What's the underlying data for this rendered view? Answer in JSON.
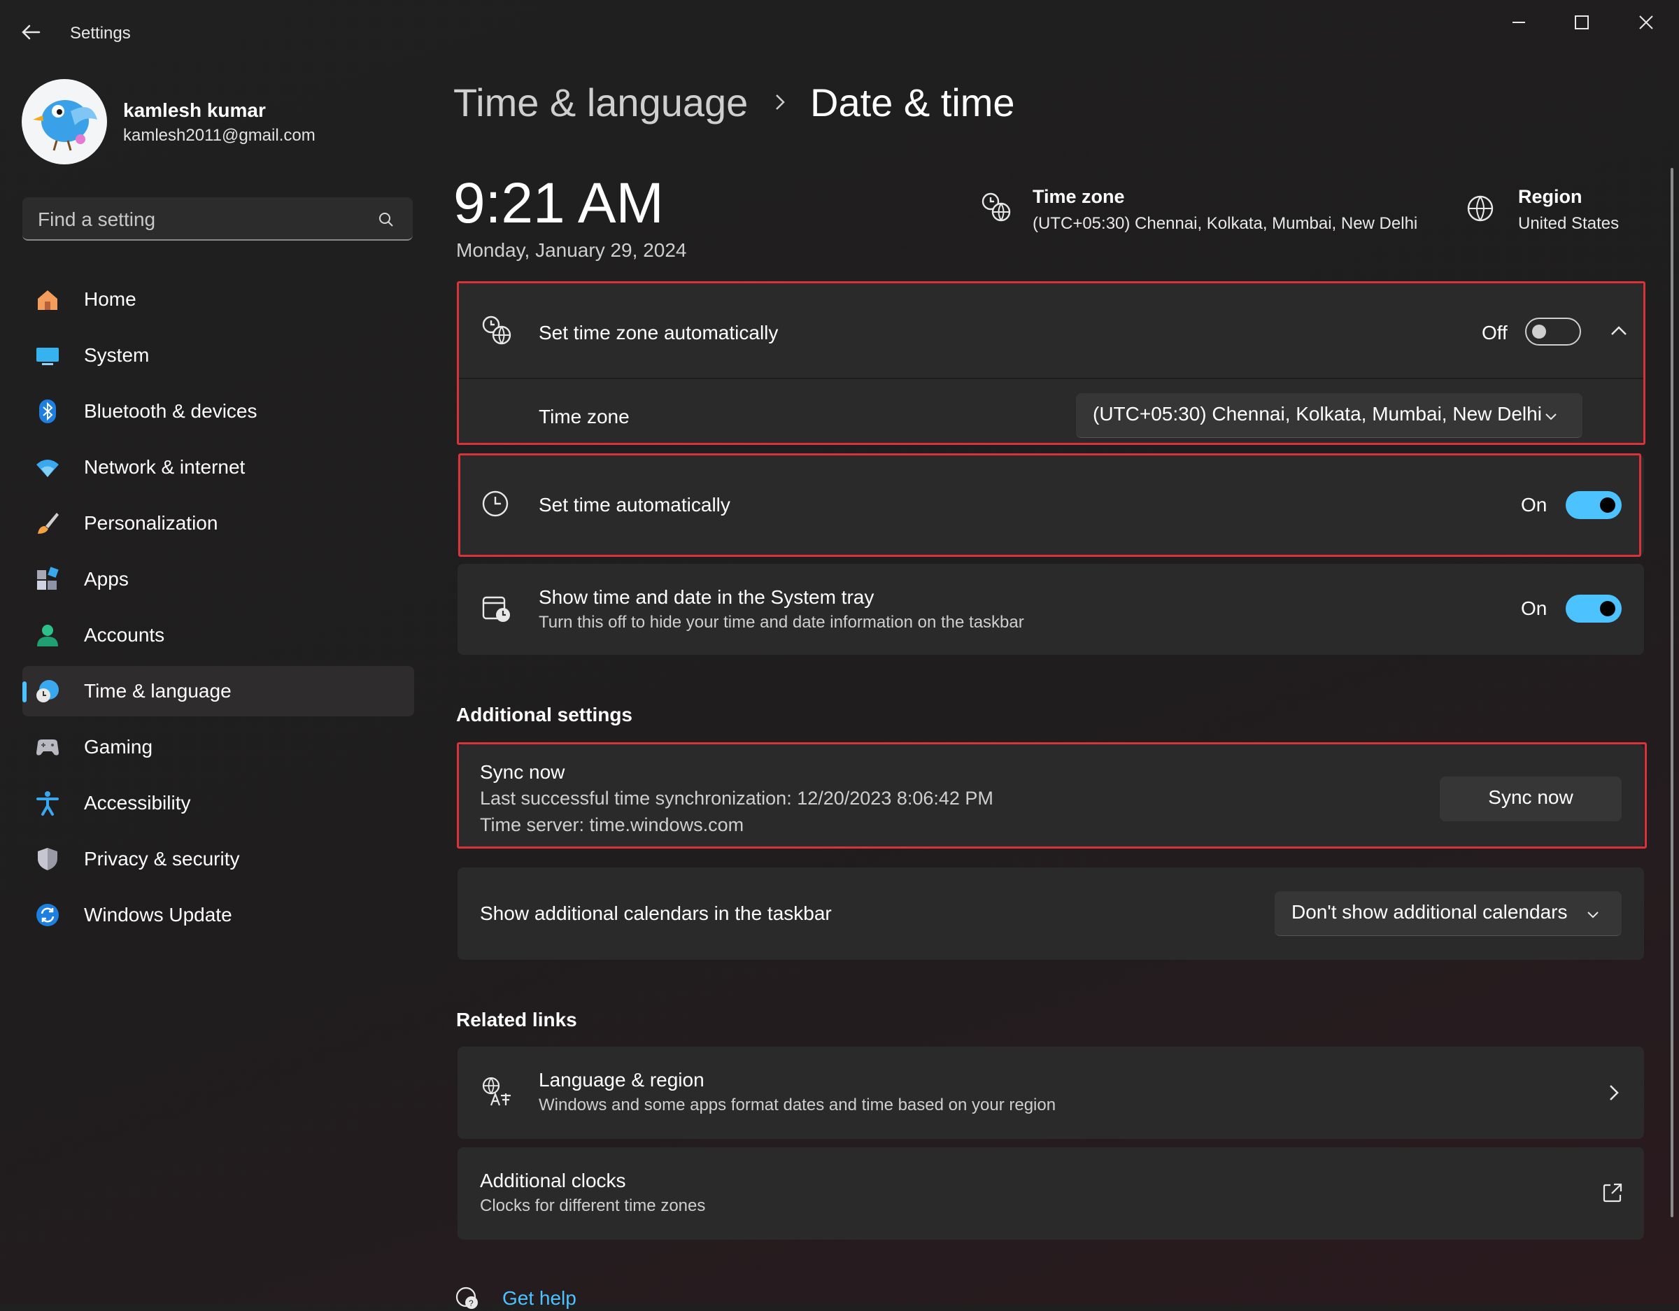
{
  "window": {
    "title": "Settings"
  },
  "profile": {
    "name": "kamlesh kumar",
    "email": "kamlesh2011@gmail.com"
  },
  "search": {
    "placeholder": "Find a setting"
  },
  "nav": {
    "items": [
      {
        "label": "Home",
        "icon": "home-icon"
      },
      {
        "label": "System",
        "icon": "system-icon"
      },
      {
        "label": "Bluetooth & devices",
        "icon": "bluetooth-icon"
      },
      {
        "label": "Network & internet",
        "icon": "wifi-icon"
      },
      {
        "label": "Personalization",
        "icon": "brush-icon"
      },
      {
        "label": "Apps",
        "icon": "apps-icon"
      },
      {
        "label": "Accounts",
        "icon": "accounts-icon"
      },
      {
        "label": "Time & language",
        "icon": "time-language-icon",
        "active": true
      },
      {
        "label": "Gaming",
        "icon": "gamepad-icon"
      },
      {
        "label": "Accessibility",
        "icon": "accessibility-icon"
      },
      {
        "label": "Privacy & security",
        "icon": "shield-icon"
      },
      {
        "label": "Windows Update",
        "icon": "update-icon"
      }
    ]
  },
  "breadcrumb": {
    "parent": "Time & language",
    "separator": "›",
    "current": "Date & time"
  },
  "clock": {
    "time": "9:21 AM",
    "date": "Monday, January 29, 2024"
  },
  "header": {
    "timezone": {
      "title": "Time zone",
      "value": "(UTC+05:30) Chennai, Kolkata, Mumbai, New Delhi"
    },
    "region": {
      "title": "Region",
      "value": "United States"
    }
  },
  "settings": {
    "auto_timezone": {
      "label": "Set time zone automatically",
      "state": "Off"
    },
    "timezone": {
      "label": "Time zone",
      "value": "(UTC+05:30) Chennai, Kolkata, Mumbai, New Delhi"
    },
    "auto_time": {
      "label": "Set time automatically",
      "state": "On"
    },
    "systray": {
      "label": "Show time and date in the System tray",
      "sub": "Turn this off to hide your time and date information on the taskbar",
      "state": "On"
    }
  },
  "additional": {
    "heading": "Additional settings",
    "sync": {
      "title": "Sync now",
      "last": "Last successful time synchronization: 12/20/2023 8:06:42 PM",
      "server": "Time server: time.windows.com",
      "button": "Sync now"
    },
    "calendars": {
      "label": "Show additional calendars in the taskbar",
      "value": "Don't show additional calendars"
    }
  },
  "related": {
    "heading": "Related links",
    "language_region": {
      "title": "Language & region",
      "sub": "Windows and some apps format dates and time based on your region"
    },
    "additional_clocks": {
      "title": "Additional clocks",
      "sub": "Clocks for different time zones"
    }
  },
  "help": {
    "label": "Get help"
  },
  "colors": {
    "accent": "#4cc2ff",
    "highlight": "#d8333a",
    "card": "#2b2a2b",
    "background": "#202020"
  }
}
